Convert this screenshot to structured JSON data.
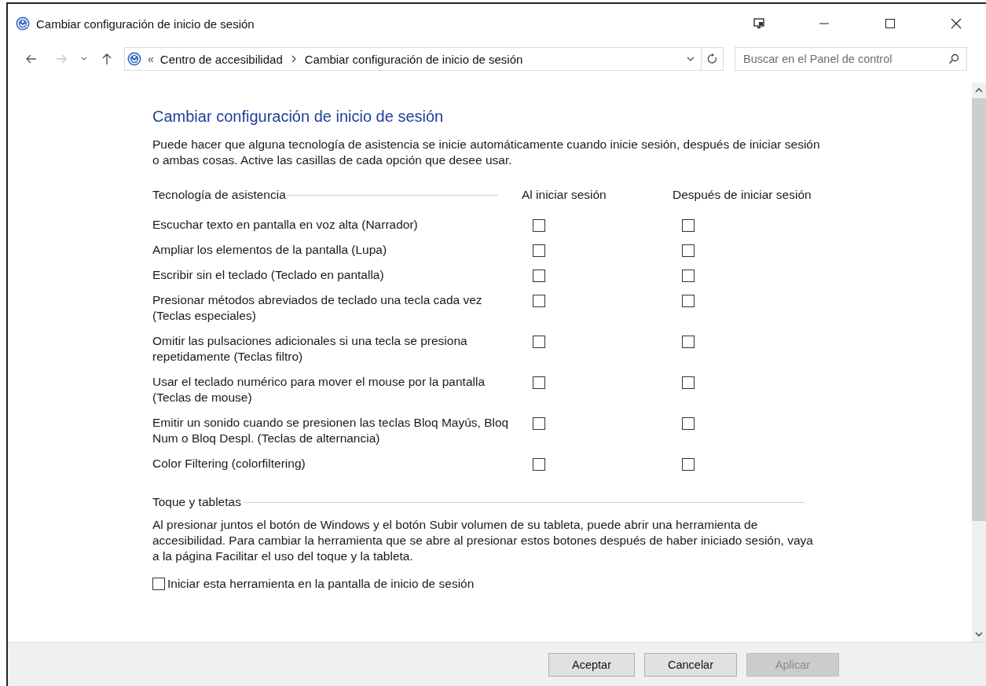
{
  "window": {
    "title": "Cambiar configuración de inicio de sesión"
  },
  "navigation": {
    "back": {
      "disabled": false
    },
    "forward": {
      "disabled": true
    }
  },
  "address_bar": {
    "overflow": "«",
    "breadcrumbs": [
      "Centro de accesibilidad",
      "Cambiar configuración de inicio de sesión"
    ]
  },
  "search": {
    "placeholder": "Buscar en el Panel de control"
  },
  "heading": "Cambiar configuración de inicio de sesión",
  "intro": "Puede hacer que alguna tecnología de asistencia se inicie automáticamente cuando inicie sesión, después de iniciar sesión o ambas cosas. Active las casillas de cada opción que desee usar.",
  "table": {
    "columns": [
      "Tecnología de asistencia",
      "Al iniciar sesión",
      "Después de iniciar sesión"
    ],
    "rows": [
      {
        "label": "Escuchar texto en pantalla en voz alta (Narrador)",
        "at_sign_in": false,
        "after_sign_in": false
      },
      {
        "label": "Ampliar los elementos de la pantalla (Lupa)",
        "at_sign_in": false,
        "after_sign_in": false
      },
      {
        "label": "Escribir sin el teclado (Teclado en pantalla)",
        "at_sign_in": false,
        "after_sign_in": false
      },
      {
        "label": "Presionar métodos abreviados de teclado una tecla cada vez (Teclas especiales)",
        "at_sign_in": false,
        "after_sign_in": false
      },
      {
        "label": "Omitir las pulsaciones adicionales si una tecla se presiona repetidamente (Teclas filtro)",
        "at_sign_in": false,
        "after_sign_in": false
      },
      {
        "label": "Usar el teclado numérico para mover el mouse por la pantalla (Teclas de mouse)",
        "at_sign_in": false,
        "after_sign_in": false
      },
      {
        "label": "Emitir un sonido cuando se presionen las teclas Bloq Mayús, Bloq Num o Bloq Despl. (Teclas de alternancia)",
        "at_sign_in": false,
        "after_sign_in": false
      },
      {
        "label": "Color Filtering (colorfiltering)",
        "at_sign_in": false,
        "after_sign_in": false
      }
    ]
  },
  "touch": {
    "title": "Toque y tabletas",
    "text": "Al presionar juntos el botón de Windows y el botón Subir volumen de su tableta, puede abrir una herramienta de accesibilidad. Para cambiar la herramienta que se abre al presionar estos botones después de haber iniciado sesión, vaya a la página Facilitar el uso del toque y la tableta.",
    "option": {
      "label": "Iniciar esta herramienta en la pantalla de inicio de sesión",
      "checked": false
    }
  },
  "buttons": [
    {
      "label": "Aceptar",
      "disabled": false
    },
    {
      "label": "Cancelar",
      "disabled": false
    },
    {
      "label": "Aplicar",
      "disabled": true
    }
  ]
}
